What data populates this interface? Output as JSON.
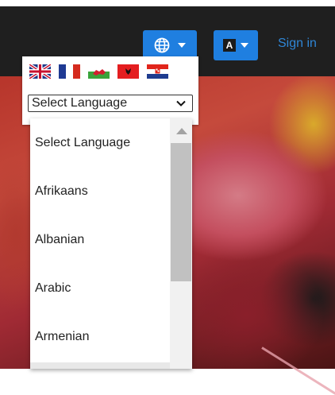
{
  "navbar": {
    "language_button_icon": "globe-icon",
    "font_button_icon": "text-a-icon",
    "font_button_letter": "A",
    "signin_label": "Sign in",
    "accent_color": "#1f7fe0"
  },
  "translator": {
    "flags": [
      "flag-uk-icon",
      "flag-france-icon",
      "flag-wales-icon",
      "flag-albania-icon",
      "flag-croatia-icon"
    ],
    "select_value": "Select Language",
    "options": [
      "Select Language",
      "Afrikaans",
      "Albanian",
      "Arabic",
      "Armenian"
    ]
  }
}
